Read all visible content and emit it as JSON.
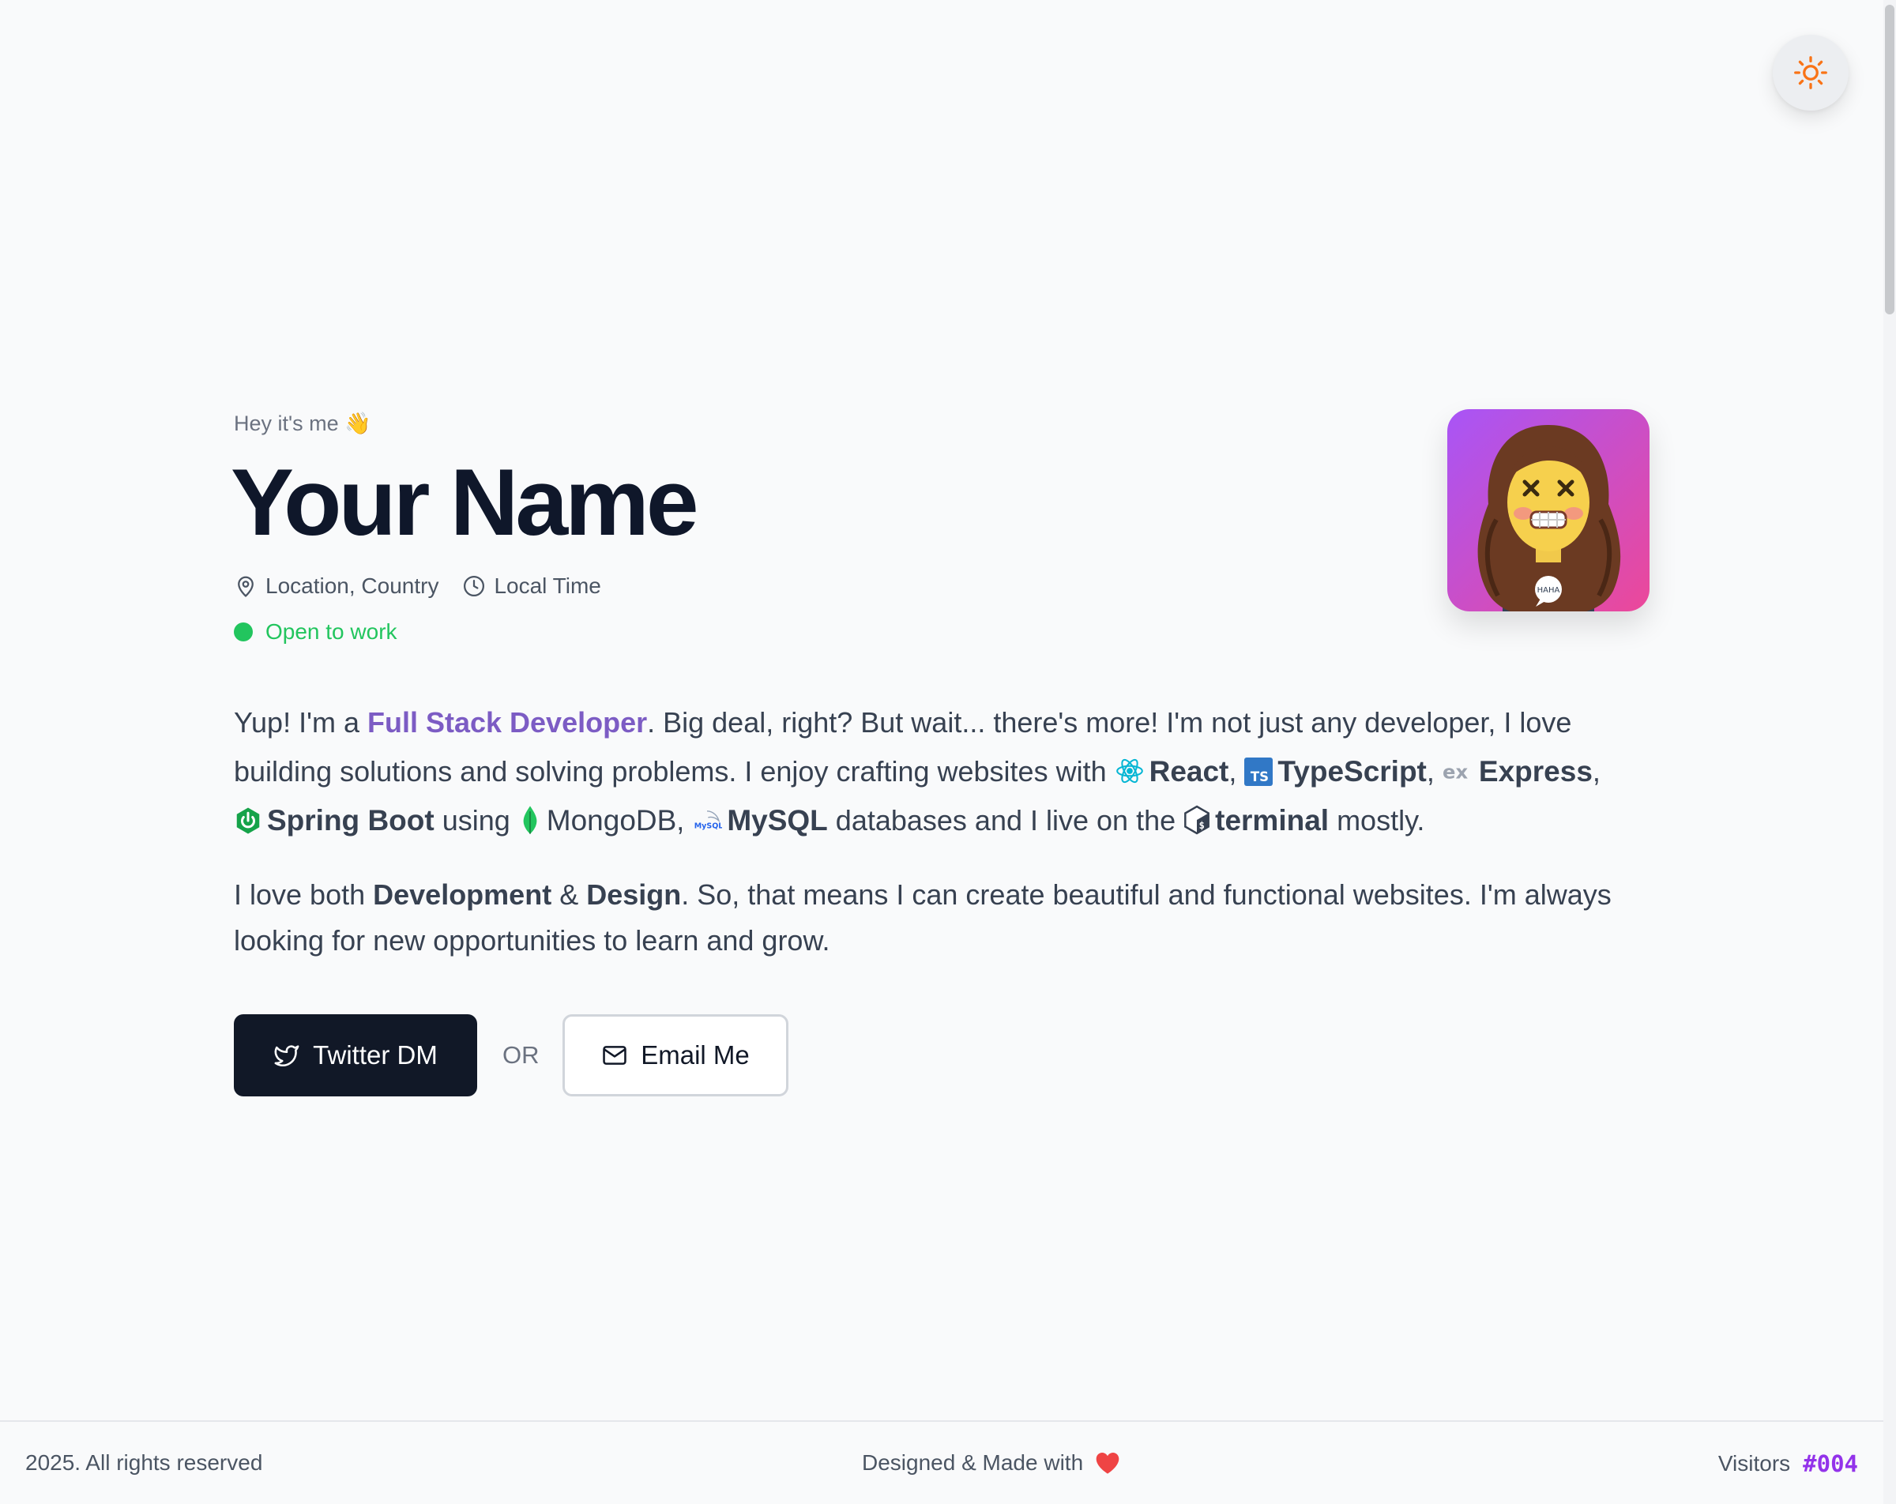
{
  "theme": {
    "icon": "sun-icon",
    "accent": "#f97316"
  },
  "hero": {
    "greeting": "Hey it's me",
    "greeting_emoji": "👋",
    "name": "Your Name",
    "location": "Location, Country",
    "time": "Local Time",
    "status": "Open to work",
    "status_color": "#22c55e"
  },
  "bio": {
    "p1_a": "Yup! I'm a ",
    "role": "Full Stack Developer",
    "p1_b": ". Big deal, right? But wait... there's more! I'm not just any developer, I love building solutions and solving problems. I enjoy crafting websites with ",
    "tech": [
      "React",
      "TypeScript",
      "Express",
      "Spring Boot",
      "MongoDB",
      "MySQL",
      "terminal"
    ],
    "sep_comma": ",",
    "word_using": " using ",
    "word_databases": " databases and I live on the ",
    "word_mostly": " mostly.",
    "p2_a": "I love both ",
    "p2_dev": "Development",
    "p2_amp": " & ",
    "p2_design": "Design",
    "p2_b": ". So, that means I can create beautiful and functional websites. I'm always looking for new opportunities to learn and grow."
  },
  "actions": {
    "twitter_label": "Twitter DM",
    "or_label": "OR",
    "email_label": "Email Me"
  },
  "footer": {
    "copyright": "2025. All rights reserved",
    "made_with": "Designed & Made with",
    "visitors_label": "Visitors",
    "visitors_count": "#004"
  }
}
